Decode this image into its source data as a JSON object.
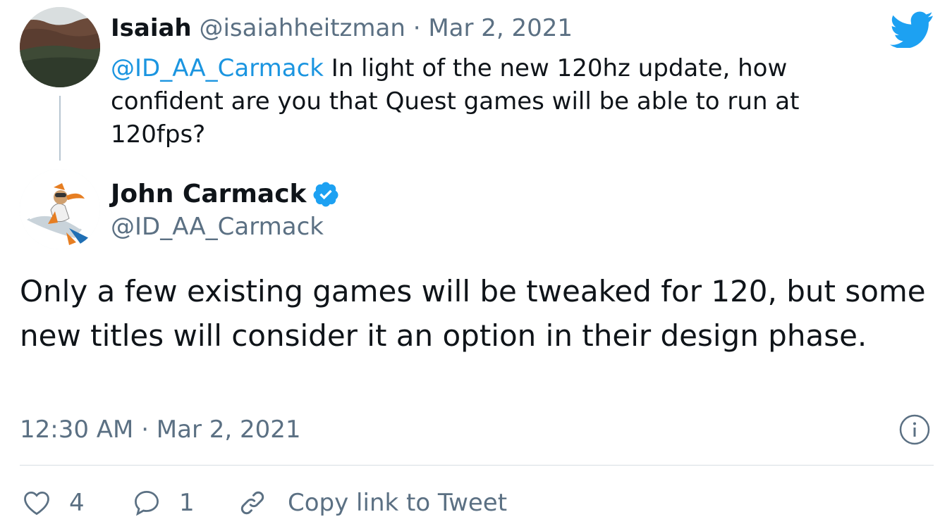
{
  "reply_tweet": {
    "author_name": "Isaiah",
    "author_handle": "@isaiahheitzman",
    "separator": "·",
    "date": "Mar 2, 2021",
    "mention": "@ID_AA_Carmack",
    "text": " In light of the new 120hz update, how confident are you that Quest games will be able to run at 120fps?"
  },
  "main_tweet": {
    "author_name": "John Carmack",
    "author_handle": "@ID_AA_Carmack",
    "verified": true,
    "text": "Only a few existing games will be tweaked for 120, but some new titles will consider it an option in their design phase.",
    "timestamp": "12:30 AM · Mar 2, 2021"
  },
  "actions": {
    "like_count": "4",
    "reply_count": "1",
    "copy_link_label": "Copy link to Tweet"
  },
  "icons": {
    "brand": "twitter-bird-icon",
    "info": "info-icon",
    "like": "heart-icon",
    "reply": "speech-bubble-icon",
    "link": "link-icon",
    "verified": "verified-badge-icon"
  },
  "colors": {
    "twitter_blue": "#1da1f2",
    "mention_blue": "#1b95e0",
    "muted_text": "#5b7083",
    "primary_text": "#0f1419"
  }
}
